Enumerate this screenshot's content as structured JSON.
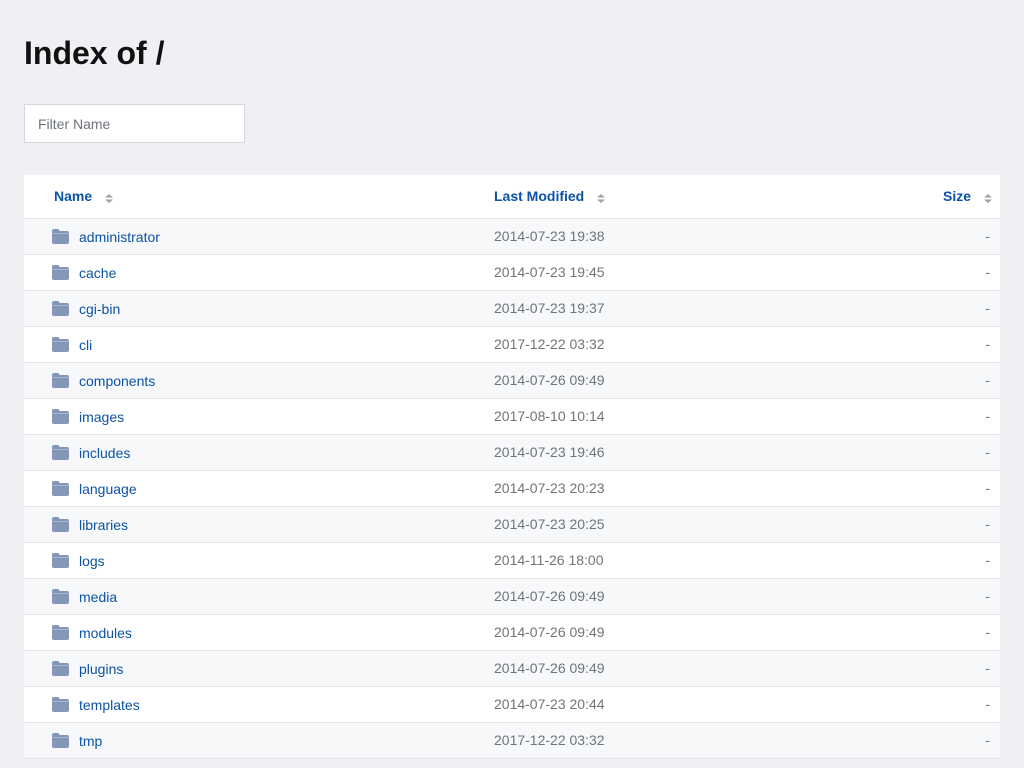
{
  "page": {
    "title": "Index of /"
  },
  "filter": {
    "placeholder": "Filter Name",
    "value": ""
  },
  "table": {
    "headers": {
      "name": "Name",
      "last_modified": "Last Modified",
      "size": "Size"
    },
    "icons": {
      "sort": "sort-arrows-icon",
      "folder": "folder-icon"
    },
    "rows": [
      {
        "name": "administrator",
        "modified": "2014-07-23 19:38",
        "size": "-"
      },
      {
        "name": "cache",
        "modified": "2014-07-23 19:45",
        "size": "-"
      },
      {
        "name": "cgi-bin",
        "modified": "2014-07-23 19:37",
        "size": "-"
      },
      {
        "name": "cli",
        "modified": "2017-12-22 03:32",
        "size": "-"
      },
      {
        "name": "components",
        "modified": "2014-07-26 09:49",
        "size": "-"
      },
      {
        "name": "images",
        "modified": "2017-08-10 10:14",
        "size": "-"
      },
      {
        "name": "includes",
        "modified": "2014-07-23 19:46",
        "size": "-"
      },
      {
        "name": "language",
        "modified": "2014-07-23 20:23",
        "size": "-"
      },
      {
        "name": "libraries",
        "modified": "2014-07-23 20:25",
        "size": "-"
      },
      {
        "name": "logs",
        "modified": "2014-11-26 18:00",
        "size": "-"
      },
      {
        "name": "media",
        "modified": "2014-07-26 09:49",
        "size": "-"
      },
      {
        "name": "modules",
        "modified": "2014-07-26 09:49",
        "size": "-"
      },
      {
        "name": "plugins",
        "modified": "2014-07-26 09:49",
        "size": "-"
      },
      {
        "name": "templates",
        "modified": "2014-07-23 20:44",
        "size": "-"
      },
      {
        "name": "tmp",
        "modified": "2017-12-22 03:32",
        "size": "-"
      }
    ]
  },
  "colors": {
    "link": "#0b53a4",
    "folder": "#8497b7",
    "muted": "#6f747a",
    "background": "#eef0f3"
  }
}
